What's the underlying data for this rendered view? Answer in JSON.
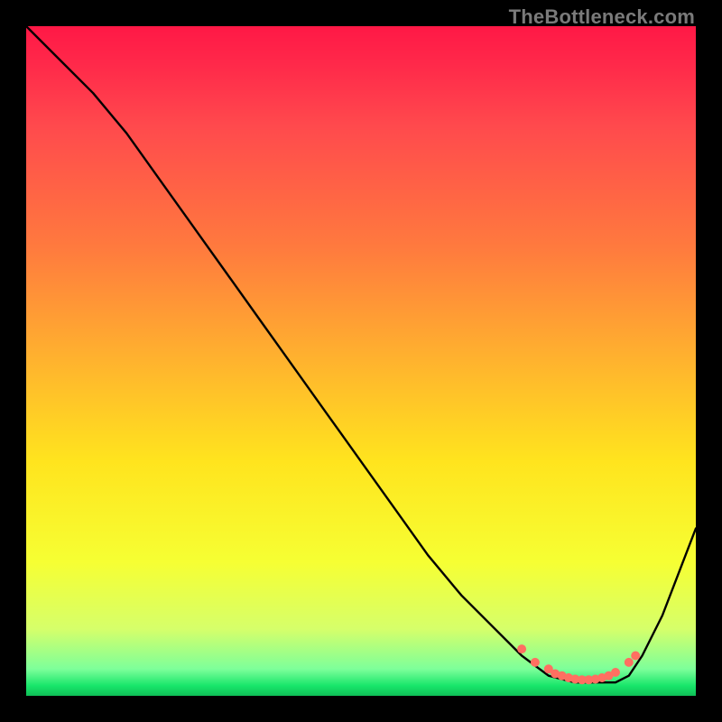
{
  "watermark": "TheBottleneck.com",
  "chart_data": {
    "type": "line",
    "title": "",
    "xlabel": "",
    "ylabel": "",
    "xlim": [
      0,
      100
    ],
    "ylim": [
      0,
      100
    ],
    "grid": false,
    "legend": false,
    "background_gradient": [
      "#ff1846",
      "#ff7a3e",
      "#ffe41e",
      "#0fbf57"
    ],
    "series": [
      {
        "name": "bottleneck-curve",
        "color": "#000000",
        "x": [
          0,
          5,
          10,
          15,
          20,
          25,
          30,
          35,
          40,
          45,
          50,
          55,
          60,
          65,
          70,
          74,
          78,
          82,
          84,
          86,
          88,
          90,
          92,
          95,
          100
        ],
        "values": [
          100,
          95,
          90,
          84,
          77,
          70,
          63,
          56,
          49,
          42,
          35,
          28,
          21,
          15,
          10,
          6,
          3,
          2,
          2,
          2,
          2,
          3,
          6,
          12,
          25
        ]
      }
    ],
    "markers": {
      "name": "highlighted-points",
      "color": "#ff6f61",
      "x": [
        74,
        76,
        78,
        79,
        80,
        81,
        82,
        83,
        84,
        85,
        86,
        87,
        88,
        90,
        91
      ],
      "values": [
        7,
        5,
        4,
        3.3,
        3,
        2.7,
        2.5,
        2.4,
        2.4,
        2.5,
        2.7,
        3,
        3.5,
        5,
        6
      ]
    }
  }
}
